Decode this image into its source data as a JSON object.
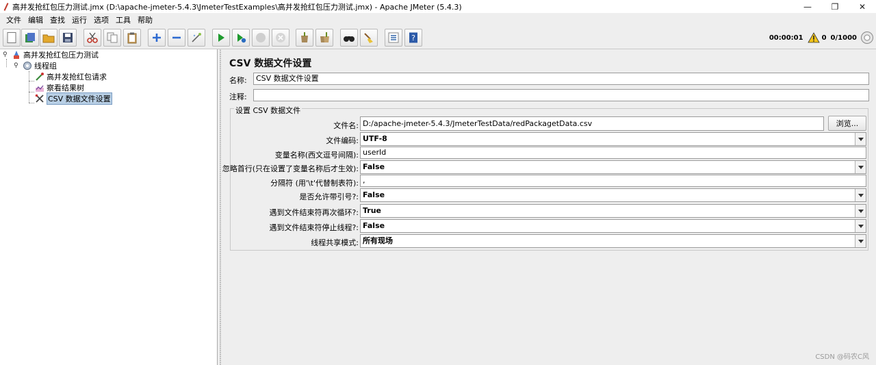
{
  "window": {
    "title": "高并发抢红包压力测试.jmx (D:\\apache-jmeter-5.4.3\\JmeterTestExamples\\高并发抢红包压力测试.jmx) - Apache JMeter (5.4.3)",
    "minimize": "—",
    "restore": "❐",
    "close": "✕"
  },
  "menu": [
    "文件",
    "编辑",
    "查找",
    "运行",
    "选项",
    "工具",
    "帮助"
  ],
  "toolbar": {
    "timer": "00:00:01",
    "warning_count": "0",
    "threads": "0/1000"
  },
  "tree": {
    "root": "高并发抢红包压力测试",
    "thread_group": "线程组",
    "sampler": "高并发抢红包请求",
    "listener": "察看结果树",
    "csv_config": "CSV 数据文件设置"
  },
  "panel": {
    "title": "CSV 数据文件设置",
    "name_label": "名称:",
    "name_value": "CSV 数据文件设置",
    "comment_label": "注释:",
    "comment_value": "",
    "group_title": "设置 CSV 数据文件",
    "filename_label": "文件名:",
    "filename_value": "D:/apache-jmeter-5.4.3/JmeterTestData/redPackagetData.csv",
    "browse_label": "浏览...",
    "encoding_label": "文件编码:",
    "encoding_value": "UTF-8",
    "varnames_label": "变量名称(西文逗号间隔):",
    "varnames_value": "userId",
    "ignore_first_label": "忽略首行(只在设置了变量名称后才生效):",
    "ignore_first_value": "False",
    "delimiter_label": "分隔符 (用'\\t'代替制表符):",
    "delimiter_value": ",",
    "quoted_label": "是否允许带引号?:",
    "quoted_value": "False",
    "recycle_label": "遇到文件结束符再次循环?:",
    "recycle_value": "True",
    "stop_thread_label": "遇到文件结束符停止线程?:",
    "stop_thread_value": "False",
    "share_mode_label": "线程共享模式:",
    "share_mode_value": "所有现场"
  },
  "watermark": "CSDN @码农C风"
}
